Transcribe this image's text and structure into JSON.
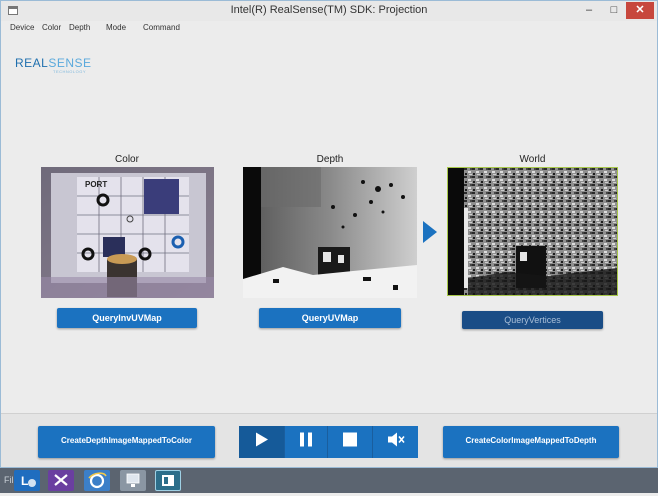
{
  "window": {
    "title": "Intel(R) RealSense(TM) SDK: Projection",
    "minimize_glyph": "–",
    "maximize_glyph": "□",
    "close_glyph": "✕"
  },
  "menu": [
    "Device",
    "Color",
    "Depth",
    "Mode",
    "Command"
  ],
  "logo": {
    "text_a": "REAL",
    "text_b": "SENSE",
    "sub": "TECHNOLOGY"
  },
  "panels": {
    "color": {
      "label": "Color",
      "button": "QueryInvUVMap"
    },
    "depth": {
      "label": "Depth",
      "button": "QueryUVMap"
    },
    "world": {
      "label": "World",
      "button": "QueryVertices"
    }
  },
  "color_image_text": "PORT",
  "bottom": {
    "left_button": "CreateDepthImageMappedToColor",
    "right_button": "CreateColorImageMappedToDepth",
    "controls": [
      "play-icon",
      "pause-icon",
      "stop-icon",
      "mute-icon"
    ]
  },
  "taskbar": {
    "label": "Fil"
  },
  "colors": {
    "accent": "#1b72c0",
    "accent_dark": "#1a4d86",
    "close": "#c7473d",
    "world_border": "#a8c84a"
  }
}
